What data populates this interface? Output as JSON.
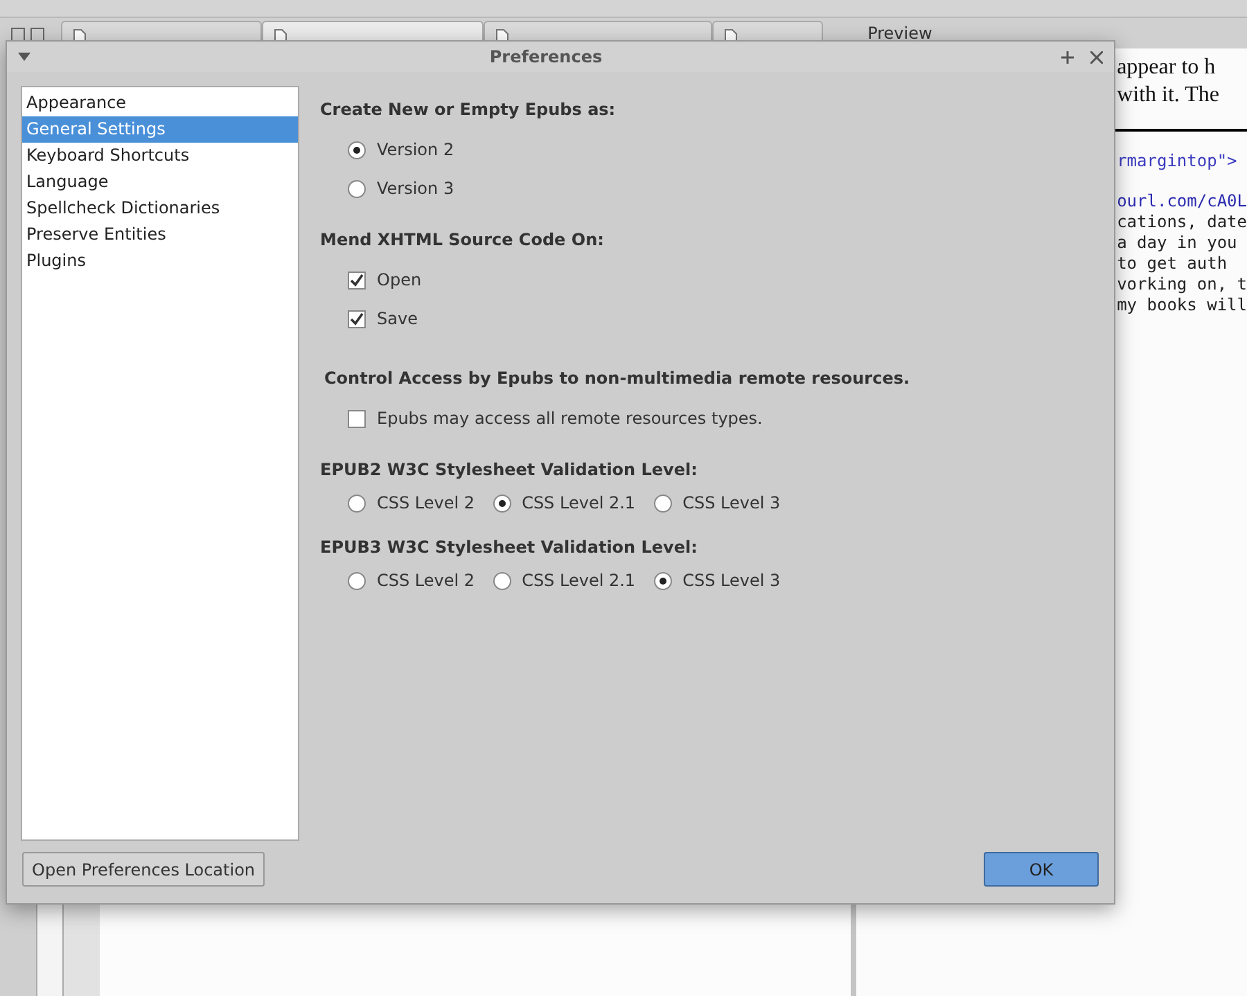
{
  "background": {
    "tabs": [
      {
        "selected": false
      },
      {
        "selected": true
      },
      {
        "selected": false
      },
      {
        "selected": false
      }
    ],
    "preview": {
      "title": "Preview",
      "text_lines": [
        "appear to h",
        "with it. The"
      ],
      "code_lines": [
        {
          "text": "rmargintop\">",
          "kind": "markup"
        },
        {
          "text": "ourl.com/cA0L",
          "kind": "link"
        },
        {
          "text": "cations, date",
          "kind": "plain"
        },
        {
          "text": "a day in you",
          "kind": "plain"
        },
        {
          "text": "to get auth",
          "kind": "plain"
        },
        {
          "text": "vorking on, t",
          "kind": "plain"
        },
        {
          "text": "my books will",
          "kind": "plain"
        }
      ]
    }
  },
  "dialog": {
    "title": "Preferences",
    "categories": [
      {
        "label": "Appearance",
        "selected": false
      },
      {
        "label": "General Settings",
        "selected": true
      },
      {
        "label": "Keyboard Shortcuts",
        "selected": false
      },
      {
        "label": "Language",
        "selected": false
      },
      {
        "label": "Spellcheck Dictionaries",
        "selected": false
      },
      {
        "label": "Preserve Entities",
        "selected": false
      },
      {
        "label": "Plugins",
        "selected": false
      }
    ],
    "sections": [
      {
        "kind": "radio",
        "heading": "Create New or Empty Epubs as:",
        "options": [
          {
            "label": "Version 2",
            "selected": true
          },
          {
            "label": "Version 3",
            "selected": false
          }
        ]
      },
      {
        "kind": "check",
        "heading": "Mend XHTML Source Code On:",
        "options": [
          {
            "label": "Open",
            "checked": true
          },
          {
            "label": "Save",
            "checked": true
          }
        ]
      },
      {
        "kind": "check",
        "heading": "Control Access by Epubs to non-multimedia remote resources.",
        "options": [
          {
            "label": "Epubs may access all remote resources types.",
            "checked": false
          }
        ]
      },
      {
        "kind": "radio_row",
        "heading": "EPUB2 W3C Stylesheet Validation Level:",
        "options": [
          {
            "label": "CSS Level 2",
            "selected": false
          },
          {
            "label": "CSS Level 2.1",
            "selected": true
          },
          {
            "label": "CSS Level 3",
            "selected": false
          }
        ]
      },
      {
        "kind": "radio_row",
        "heading": "EPUB3 W3C Stylesheet Validation Level:",
        "options": [
          {
            "label": "CSS Level 2",
            "selected": false
          },
          {
            "label": "CSS Level 2.1",
            "selected": false
          },
          {
            "label": "CSS Level 3",
            "selected": true
          }
        ]
      }
    ],
    "location_button": "Open Preferences Location",
    "ok_button": "OK"
  }
}
